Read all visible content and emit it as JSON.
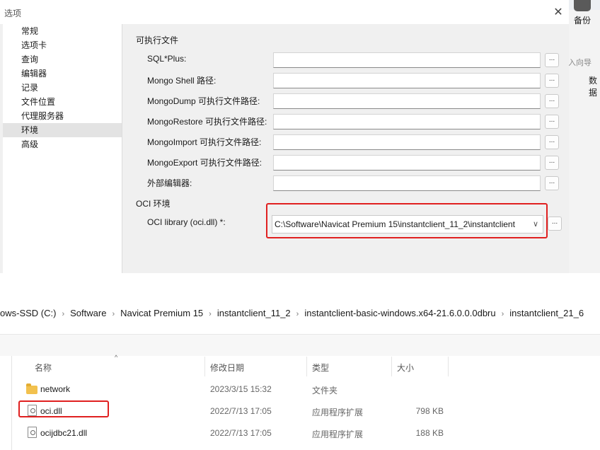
{
  "dialog": {
    "title": "选项",
    "close_glyph": "✕",
    "nav_items": [
      "常规",
      "选项卡",
      "查询",
      "编辑器",
      "记录",
      "文件位置",
      "代理服务器",
      "环境",
      "高级"
    ],
    "active_nav": "环境",
    "section_exec": "可执行文件",
    "fields": [
      {
        "label": "SQL*Plus:",
        "value": ""
      },
      {
        "label": "Mongo Shell 路径:",
        "value": ""
      },
      {
        "label": "MongoDump 可执行文件路径:",
        "value": ""
      },
      {
        "label": "MongoRestore 可执行文件路径:",
        "value": ""
      },
      {
        "label": "MongoImport 可执行文件路径:",
        "value": ""
      },
      {
        "label": "MongoExport 可执行文件路径:",
        "value": ""
      },
      {
        "label": "外部编辑器:",
        "value": ""
      }
    ],
    "browse_label": "...",
    "section_oci": "OCI 环境",
    "oci_label": "OCI library (oci.dll) *:",
    "oci_value": "C:\\Software\\Navicat Premium 15\\instantclient_11_2\\instantclient",
    "chevron_glyph": "∨"
  },
  "background_app": {
    "backup_label": "备份",
    "wizard_label": "入向导",
    "data_label": "数据"
  },
  "explorer": {
    "breadcrumb": [
      "ows-SSD (C:)",
      "Software",
      "Navicat Premium 15",
      "instantclient_11_2",
      "instantclient-basic-windows.x64-21.6.0.0.0dbru",
      "instantclient_21_6"
    ],
    "separator": "›",
    "columns": {
      "name": "名称",
      "modified": "修改日期",
      "type": "类型",
      "size": "大小"
    },
    "sort_glyph": "^",
    "files": [
      {
        "name": "network",
        "modified": "2023/3/15 15:32",
        "type": "文件夹",
        "size": "",
        "icon": "folder-icon"
      },
      {
        "name": "oci.dll",
        "modified": "2022/7/13 17:05",
        "type": "应用程序扩展",
        "size": "798 KB",
        "icon": "dll-file-icon"
      },
      {
        "name": "ocijdbc21.dll",
        "modified": "2022/7/13 17:05",
        "type": "应用程序扩展",
        "size": "188 KB",
        "icon": "dll-file-icon"
      }
    ]
  },
  "colors": {
    "highlight": "#e02020",
    "folder": "#f2c14e",
    "accent": "#4a77b8"
  }
}
